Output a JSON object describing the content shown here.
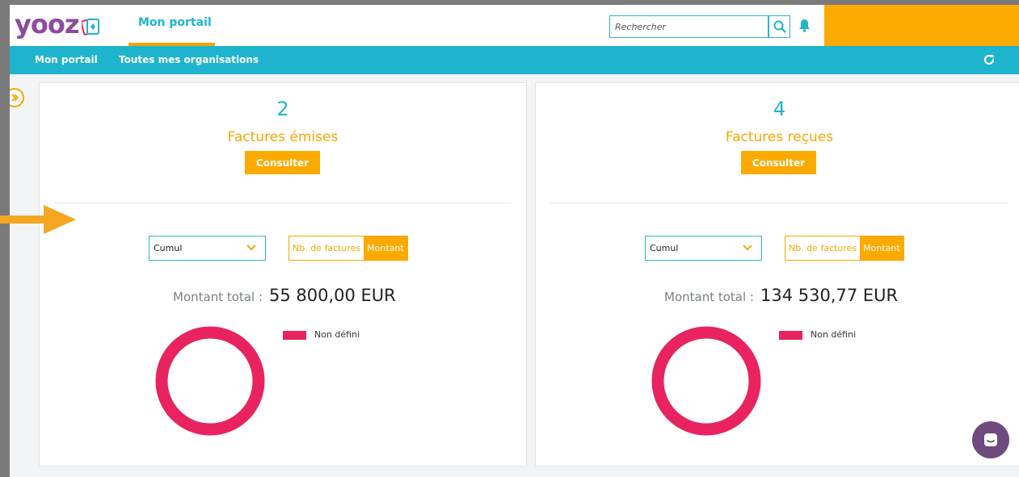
{
  "header": {
    "logo_text": "yooz",
    "portal_tab": "Mon portail",
    "search_placeholder": "Rechercher"
  },
  "nav": {
    "items": [
      "Mon portail",
      "Toutes mes organisations"
    ]
  },
  "cards": [
    {
      "count": "2",
      "title": "Factures émises",
      "button": "Consulter",
      "select_value": "Cumul",
      "toggle_count": "Nb. de factures",
      "toggle_amount": "Montant",
      "total_label": "Montant total :",
      "total_value": "55 800,00 EUR",
      "legend": "Non défini"
    },
    {
      "count": "4",
      "title": "Factures reçues",
      "button": "Consulter",
      "select_value": "Cumul",
      "toggle_count": "Nb. de factures",
      "toggle_amount": "Montant",
      "total_label": "Montant total :",
      "total_value": "134 530,77 EUR",
      "legend": "Non défini"
    }
  ],
  "icons": [
    "search-icon",
    "bell-icon",
    "refresh-icon",
    "expand-icon",
    "chevron-down-icon",
    "chat-icon",
    "arrow-icon"
  ],
  "colors": {
    "brand_purple": "#8b4c9c",
    "accent_orange": "#fdaa00",
    "teal": "#1fb4cd",
    "donut_pink": "#e8235f",
    "chat_purple": "#6e4a7e"
  }
}
